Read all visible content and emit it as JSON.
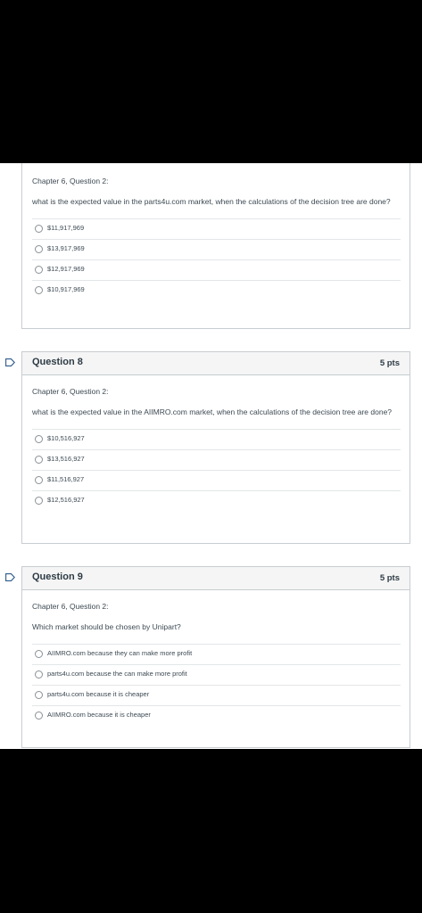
{
  "questions": [
    {
      "title": "",
      "points": "",
      "chapter": "Chapter 6, Question 2:",
      "text": "what is the expected value in the parts4u.com market, when the calculations of the decision tree are done?",
      "answers": [
        "$11,917,969",
        "$13,917,969",
        "$12,917,969",
        "$10,917,969"
      ]
    },
    {
      "title": "Question 8",
      "points": "5 pts",
      "chapter": "Chapter 6, Question 2:",
      "text": "what is the expected value in the AIIMRO.com market, when the calculations of the decision tree are done?",
      "answers": [
        "$10,516,927",
        "$13,516,927",
        "$11,516,927",
        "$12,516,927"
      ]
    },
    {
      "title": "Question 9",
      "points": "5 pts",
      "chapter": "Chapter 6, Question 2:",
      "text": "Which market should be chosen by Unipart?",
      "answers": [
        "AIIMRO.com because they can make more profit",
        "parts4u.com because the can make more profit",
        "parts4u.com because it is cheaper",
        "AIIMRO.com because it is cheaper"
      ]
    }
  ],
  "colors": {
    "flag": "#2d5a8c",
    "header_bg": "#f5f5f5",
    "border": "#c7cdd1"
  }
}
